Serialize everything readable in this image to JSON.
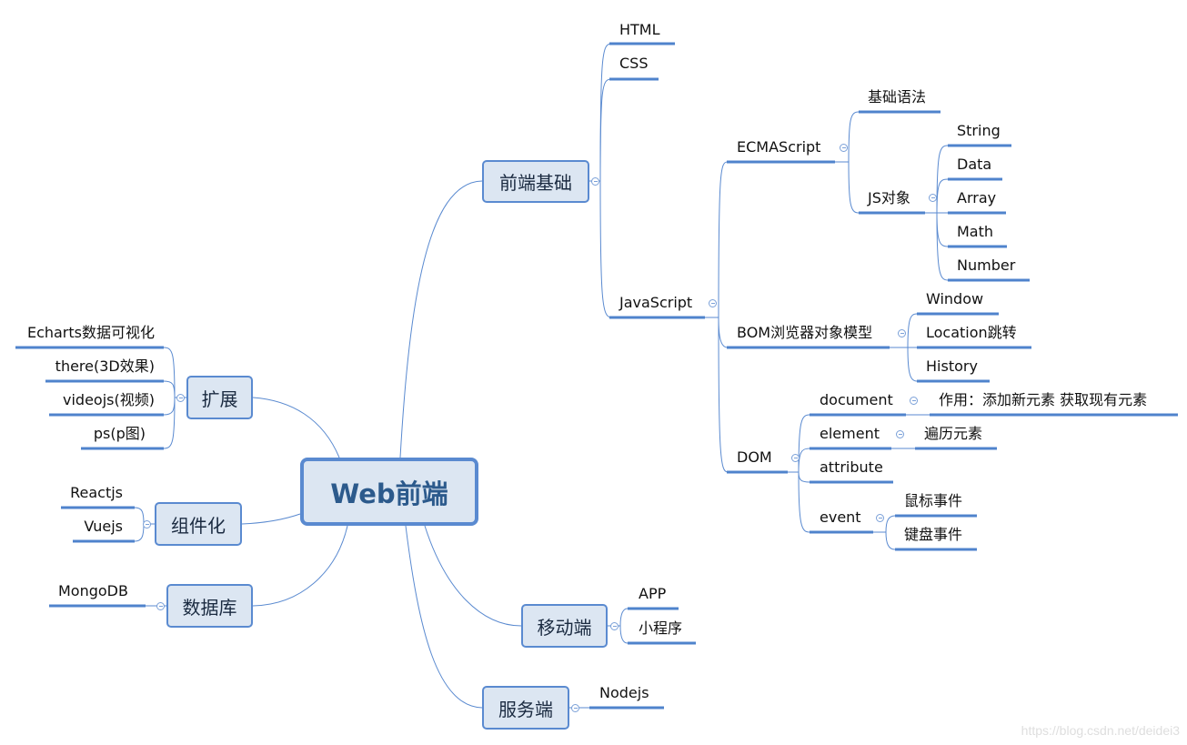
{
  "root": {
    "label": "Web前端"
  },
  "colors": {
    "line": "#5a8ad0",
    "underline": "#4f83cc",
    "box_fill": "#dce6f2",
    "box_border": "#5a8ad0",
    "root_text": "#2c5a8c"
  },
  "branches": {
    "frontend_basics": {
      "label": "前端基础",
      "children": {
        "html": "HTML",
        "css": "CSS",
        "javascript": {
          "label": "JavaScript",
          "children": {
            "ecmascript": {
              "label": "ECMAScript",
              "children": {
                "basic_syntax": "基础语法",
                "js_objects": {
                  "label": "JS对象",
                  "children": [
                    "String",
                    "Data",
                    "Array",
                    "Math",
                    "Number"
                  ]
                }
              }
            },
            "bom": {
              "label": "BOM浏览器对象模型",
              "children": [
                "Window",
                "Location跳转",
                "History"
              ]
            },
            "dom": {
              "label": "DOM",
              "children": {
                "document": {
                  "label": "document",
                  "note": "作用：添加新元素 获取现有元素"
                },
                "element": {
                  "label": "element",
                  "note": "遍历元素"
                },
                "attribute": {
                  "label": "attribute"
                },
                "event": {
                  "label": "event",
                  "children": [
                    "鼠标事件",
                    "键盘事件"
                  ]
                }
              }
            }
          }
        }
      }
    },
    "extension": {
      "label": "扩展",
      "children": [
        "Echarts数据可视化",
        "there(3D效果)",
        "videojs(视频)",
        "ps(p图)"
      ]
    },
    "componentization": {
      "label": "组件化",
      "children": [
        "Reactjs",
        "Vuejs"
      ]
    },
    "database": {
      "label": "数据库",
      "children": [
        "MongoDB"
      ]
    },
    "mobile": {
      "label": "移动端",
      "children": [
        "APP",
        "小程序"
      ]
    },
    "server": {
      "label": "服务端",
      "children": [
        "Nodejs"
      ]
    }
  },
  "watermark": "https://blog.csdn.net/deidei3"
}
